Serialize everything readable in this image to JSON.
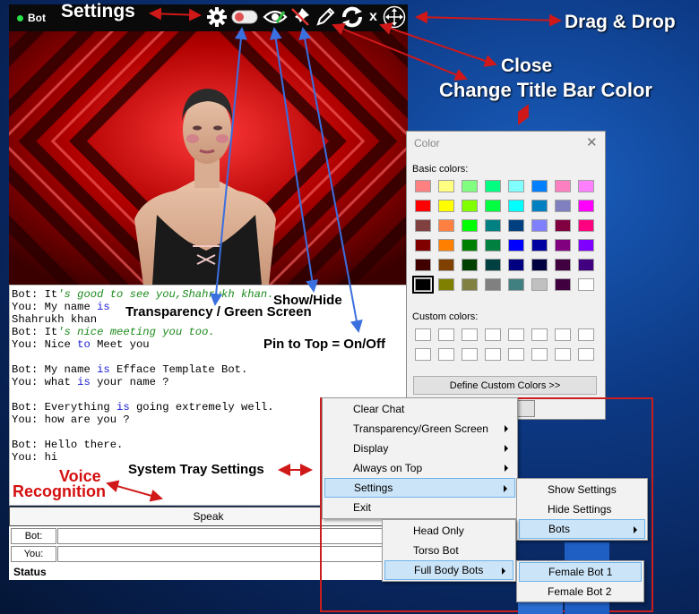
{
  "bot_window": {
    "title": "Bot",
    "close_glyph": "x",
    "chat_lines": [
      {
        "prefix": "Bot: It",
        "rest": "'s good to see you,Shahrukh khan.",
        "style": "green"
      },
      {
        "prefix": "You: My name ",
        "kw": "is",
        "rest": ""
      },
      {
        "prefix": "Shahrukh khan",
        "rest": ""
      },
      {
        "prefix": "Bot: It",
        "rest": "'s nice meeting you too.",
        "style": "green"
      },
      {
        "prefix": "You: Nice ",
        "kw": "to",
        "rest": " Meet you"
      },
      {
        "prefix": "",
        "rest": ""
      },
      {
        "prefix": "Bot: My name ",
        "kw": "is",
        "rest": " Efface Template Bot."
      },
      {
        "prefix": "You: what ",
        "kw": "is",
        "rest": " your name ?"
      },
      {
        "prefix": "",
        "rest": ""
      },
      {
        "prefix": "Bot: Everything ",
        "kw": "is",
        "rest": " going extremely well."
      },
      {
        "prefix": "You: how are you ?",
        "rest": ""
      },
      {
        "prefix": "",
        "rest": ""
      },
      {
        "prefix": "Bot: Hello there.",
        "rest": ""
      },
      {
        "prefix": "You: hi",
        "rest": ""
      }
    ],
    "speak_label": "Speak",
    "bot_label": "Bot:",
    "you_label": "You:",
    "status_label": "Status",
    "toolbar_icons": [
      "gear-icon",
      "toggle-icon",
      "eye-icon",
      "pin-icon",
      "pencil-icon",
      "refresh-icon",
      "close-icon",
      "move-icon"
    ]
  },
  "annotations": {
    "settings": "Settings",
    "drag_drop": "Drag & Drop",
    "close": "Close",
    "change_title_bar_color": "Change Title Bar Color",
    "show_hide": "Show/Hide",
    "transparency": "Transparency / Green Screen",
    "pin_to_top": "Pin to Top = On/Off",
    "system_tray": "System Tray Settings",
    "voice": "Voice",
    "recognition": "Recognition"
  },
  "color_dialog": {
    "title": "Color",
    "close_glyph": "✕",
    "basic_colors_label": "Basic colors:",
    "custom_colors_label": "Custom colors:",
    "define_button": "Define Custom Colors >>",
    "basic_colors": [
      [
        "#ff8080",
        "#ffff80",
        "#80ff80",
        "#00ff80",
        "#80ffff",
        "#0080ff",
        "#ff80c0",
        "#ff80ff"
      ],
      [
        "#ff0000",
        "#ffff00",
        "#80ff00",
        "#00ff40",
        "#00ffff",
        "#0080c0",
        "#8080c0",
        "#ff00ff"
      ],
      [
        "#804040",
        "#ff8040",
        "#00ff00",
        "#008080",
        "#004080",
        "#8080ff",
        "#800040",
        "#ff0080"
      ],
      [
        "#800000",
        "#ff8000",
        "#008000",
        "#008040",
        "#0000ff",
        "#0000a0",
        "#800080",
        "#8000ff"
      ],
      [
        "#400000",
        "#804000",
        "#004000",
        "#004040",
        "#000080",
        "#000040",
        "#400040",
        "#400080"
      ],
      [
        "#000000",
        "#808000",
        "#808040",
        "#808080",
        "#408080",
        "#c0c0c0",
        "#400040",
        "#ffffff"
      ]
    ],
    "selected_color": "#000000"
  },
  "menus": {
    "main": [
      {
        "label": "Clear Chat",
        "submenu": false
      },
      {
        "label": "Transparency/Green Screen",
        "submenu": true
      },
      {
        "label": "Display",
        "submenu": true
      },
      {
        "label": "Always on Top",
        "submenu": true
      },
      {
        "label": "Settings",
        "submenu": true,
        "highlighted": true
      },
      {
        "label": "Exit",
        "submenu": false
      }
    ],
    "settings": [
      {
        "label": "Show Settings",
        "submenu": false
      },
      {
        "label": "Hide Settings",
        "submenu": false
      },
      {
        "label": "Bots",
        "submenu": true,
        "highlighted": true
      }
    ],
    "bots": [
      {
        "label": "Head Only",
        "submenu": false
      },
      {
        "label": "Torso Bot",
        "submenu": false
      },
      {
        "label": "Full Body Bots",
        "submenu": true,
        "highlighted": true
      }
    ],
    "full_body": [
      {
        "label": "Female Bot 1",
        "highlighted": true
      },
      {
        "label": "Female Bot 2"
      }
    ]
  },
  "colors": {
    "annotation_arrow": "#d01818",
    "pointer_arrow": "#3a6fe0",
    "menu_highlight": "#cce4f7",
    "menu_border": "#c81e1e"
  }
}
